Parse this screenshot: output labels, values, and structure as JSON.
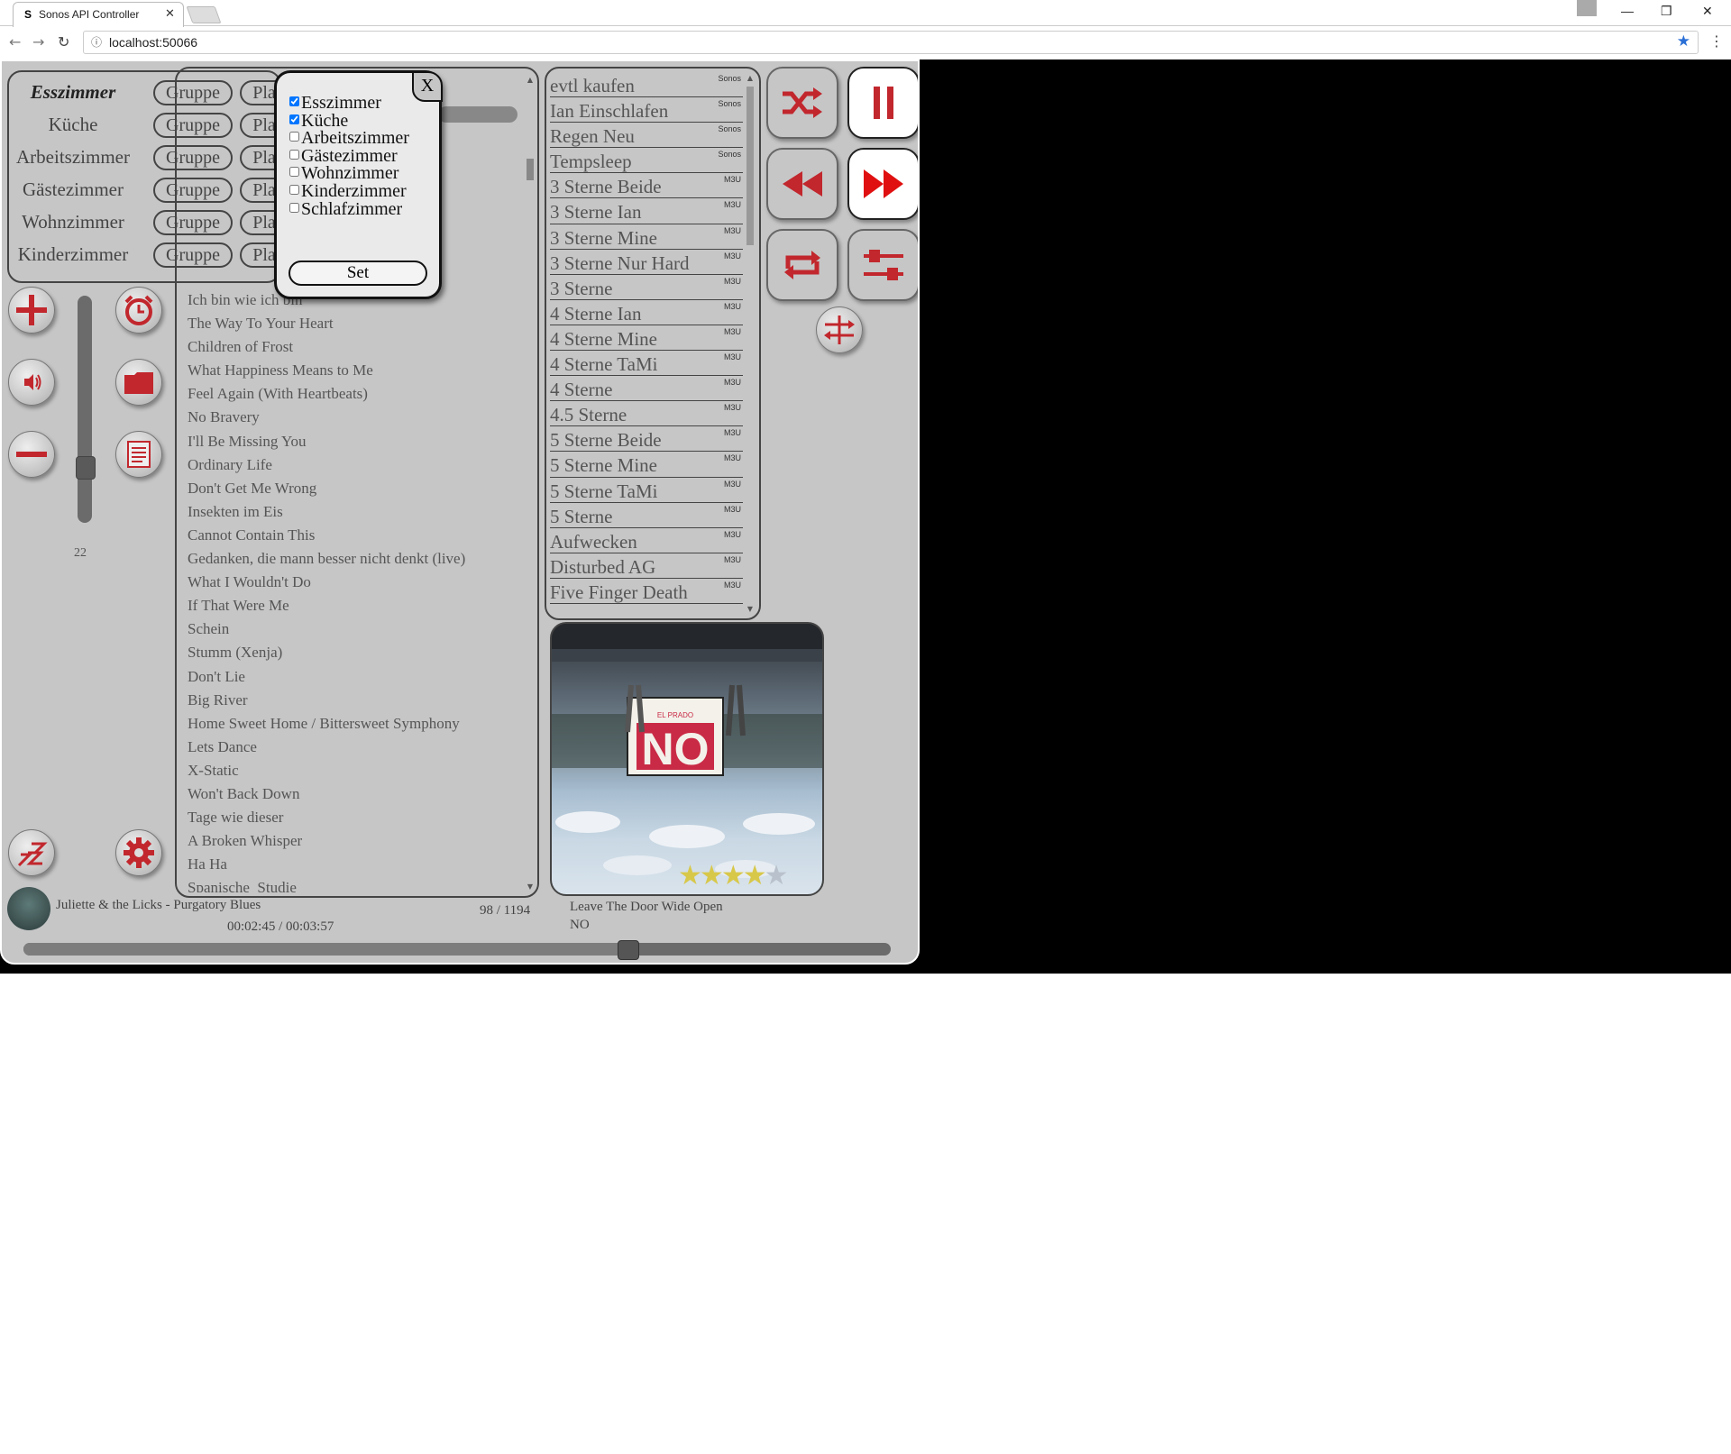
{
  "browser": {
    "tab_title": "Sonos API Controller",
    "tab_favicon": "S",
    "tab_close": "✕",
    "url": "localhost:50066",
    "star_icon": "★",
    "menu_icon": "⋮",
    "window_minimize": "—",
    "window_restore": "❐",
    "window_close": "✕",
    "nav_back": "←",
    "nav_forward": "→",
    "nav_reload": "↻",
    "info_icon": "ⓘ"
  },
  "rooms": [
    {
      "name": "Esszimmer",
      "active": true,
      "group_label": "Gruppe",
      "play_label": "Pla"
    },
    {
      "name": "Küche",
      "group_label": "Gruppe",
      "play_label": "Pla"
    },
    {
      "name": "Arbeitszimmer",
      "group_label": "Gruppe",
      "play_label": "Pla"
    },
    {
      "name": "Gästezimmer",
      "group_label": "Gruppe",
      "play_label": "Pla"
    },
    {
      "name": "Wohnzimmer",
      "group_label": "Gruppe",
      "play_label": "Pla"
    },
    {
      "name": "Kinderzimmer",
      "group_label": "Gruppe",
      "play_label": "Pla"
    }
  ],
  "group_dialog": {
    "close_label": "X",
    "set_label": "Set",
    "rooms": [
      {
        "name": "Esszimmer",
        "checked": true
      },
      {
        "name": "Küche",
        "checked": true
      },
      {
        "name": "Arbeitszimmer",
        "checked": false
      },
      {
        "name": "Gästezimmer",
        "checked": false
      },
      {
        "name": "Wohnzimmer",
        "checked": false
      },
      {
        "name": "Kinderzimmer",
        "checked": false
      },
      {
        "name": "Schlafzimmer",
        "checked": false
      }
    ]
  },
  "playlist": [
    "Ich bin wie ich bin",
    "The Way To Your Heart",
    "Children of Frost",
    "What Happiness Means to Me",
    "Feel Again (With Heartbeats)",
    "No Bravery",
    "I'll Be Missing You",
    "Ordinary Life",
    "Don't Get Me Wrong",
    "Insekten im Eis",
    "Cannot Contain This",
    "Gedanken, die mann besser nicht denkt (live)",
    "What I Wouldn't Do",
    "If That Were Me",
    "Schein",
    "Stumm (Xenja)",
    "Don't Lie",
    "Big River",
    "Home Sweet Home / Bittersweet Symphony",
    "Lets Dance",
    "X-Static",
    "Won't Back Down",
    "Tage wie dieser",
    "A Broken Whisper",
    "Ha Ha",
    "Spanische_Studie"
  ],
  "favorites": [
    {
      "name": "evtl kaufen",
      "type": "Sonos"
    },
    {
      "name": "Ian Einschlafen",
      "type": "Sonos"
    },
    {
      "name": "Regen Neu",
      "type": "Sonos"
    },
    {
      "name": "Tempsleep",
      "type": "Sonos"
    },
    {
      "name": "3 Sterne Beide",
      "type": "M3U"
    },
    {
      "name": "3 Sterne Ian",
      "type": "M3U"
    },
    {
      "name": "3 Sterne Mine",
      "type": "M3U"
    },
    {
      "name": "3 Sterne Nur Hard",
      "type": "M3U"
    },
    {
      "name": "3 Sterne",
      "type": "M3U"
    },
    {
      "name": "4 Sterne Ian",
      "type": "M3U"
    },
    {
      "name": "4 Sterne Mine",
      "type": "M3U"
    },
    {
      "name": "4 Sterne TaMi",
      "type": "M3U"
    },
    {
      "name": "4 Sterne",
      "type": "M3U"
    },
    {
      "name": "4.5 Sterne",
      "type": "M3U"
    },
    {
      "name": "5 Sterne Beide",
      "type": "M3U"
    },
    {
      "name": "5 Sterne Mine",
      "type": "M3U"
    },
    {
      "name": "5 Sterne TaMi",
      "type": "M3U"
    },
    {
      "name": "5 Sterne",
      "type": "M3U"
    },
    {
      "name": "Aufwecken",
      "type": "M3U"
    },
    {
      "name": "Disturbed AG",
      "type": "M3U"
    },
    {
      "name": "Five Finger Death",
      "type": "M3U"
    }
  ],
  "volume": {
    "value": "22",
    "level": 0.22
  },
  "now_playing": {
    "artist_title": "Juliette & the Licks - Purgatory Blues",
    "time": "00:02:45 / 00:03:57",
    "position": "98 / 1194",
    "next_title": "Leave The Door Wide Open",
    "next_artist": "NO",
    "progress": 0.696
  },
  "cover": {
    "sign_top": "EL PRADO",
    "sign_text": "NO",
    "rating_filled": 4,
    "rating_max": 5,
    "star_filled_char": "★",
    "star_empty_char": "★"
  },
  "colors": {
    "accent": "#c1272d",
    "panel_bg": "#c6c6c6",
    "outline": "#444444",
    "star_gold": "#d8c84a"
  }
}
